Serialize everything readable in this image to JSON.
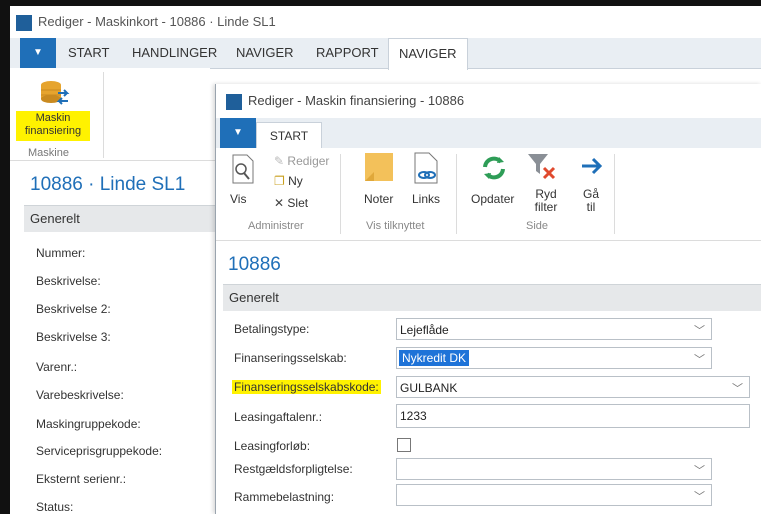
{
  "outer_window": {
    "title": "Rediger - Maskinkort - 10886 · Linde SL1",
    "tabs": [
      "START",
      "HANDLINGER",
      "NAVIGER",
      "RAPPORT",
      "NAVIGER"
    ],
    "ribbon_action": {
      "label": "Maskin finansiering",
      "group": "Maskine",
      "icon": "finance-coins-icon"
    },
    "card_title": "10886 · Linde SL1",
    "section": "Generelt",
    "fields": [
      "Nummer:",
      "Beskrivelse:",
      "Beskrivelse 2:",
      "Beskrivelse 3:",
      "Varenr.:",
      "Varebeskrivelse:",
      "Maskingruppekode:",
      "Serviceprisgruppekode:",
      "Eksternt serienr.:",
      "Status:"
    ]
  },
  "inner_window": {
    "title": "Rediger - Maskin finansiering - 10886",
    "tab": "START",
    "ribbon": {
      "administrer": {
        "vis": "Vis",
        "rediger": "Rediger",
        "ny": "Ny",
        "slet": "Slet",
        "group": "Administrer"
      },
      "vis_tilknyttet": {
        "noter": "Noter",
        "links": "Links",
        "group": "Vis tilknyttet"
      },
      "side": {
        "opdater": "Opdater",
        "ryd_filter": "Ryd filter",
        "gaa_til": "Gå til",
        "group": "Side"
      }
    },
    "card_title": "10886",
    "section": "Generelt",
    "fields": [
      {
        "label": "Betalingstype:",
        "value": "Lejeflåde",
        "type": "select"
      },
      {
        "label": "Finanseringsselskab:",
        "value": "Nykredit DK",
        "type": "select"
      },
      {
        "label": "Finanseringsselskabskode:",
        "value": "GULBANK",
        "type": "select"
      },
      {
        "label": "Leasingaftalenr.:",
        "value": "1233",
        "type": "text"
      },
      {
        "label": "Leasingforløb:",
        "value": "",
        "type": "checkbox"
      },
      {
        "label": "Restgældsforpligtelse:",
        "value": "",
        "type": "select"
      },
      {
        "label": "Rammebelastning:",
        "value": "",
        "type": "select"
      }
    ]
  },
  "colors": {
    "accent": "#1f6fb8",
    "highlight": "#fff200",
    "selected": "#1e73d8"
  }
}
